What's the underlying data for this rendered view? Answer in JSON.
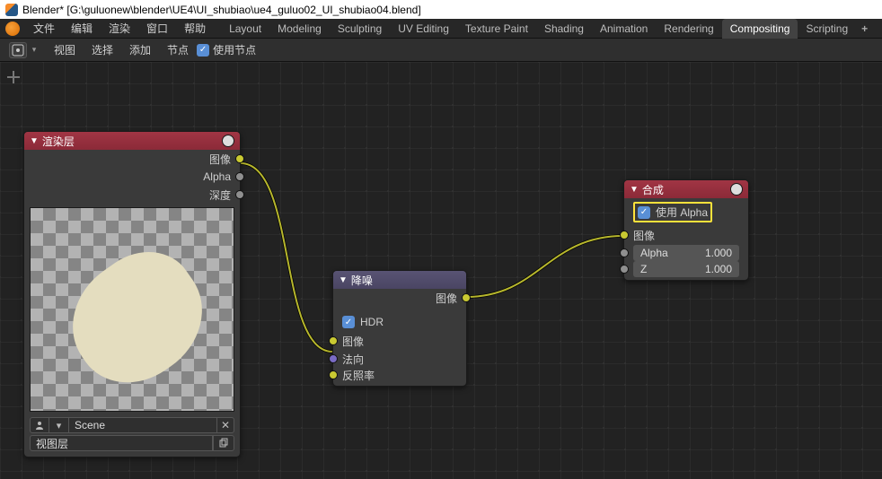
{
  "title": "Blender* [G:\\guluonew\\blender\\UE4\\UI_shubiao\\ue4_guluo02_UI_shubiao04.blend]",
  "topmenu": {
    "file": "文件",
    "edit": "编辑",
    "render": "渲染",
    "window": "窗口",
    "help": "帮助"
  },
  "workspaces": [
    "Layout",
    "Modeling",
    "Sculpting",
    "UV Editing",
    "Texture Paint",
    "Shading",
    "Animation",
    "Rendering",
    "Compositing",
    "Scripting"
  ],
  "header2": {
    "view": "视图",
    "select": "选择",
    "add": "添加",
    "node": "节点",
    "use_nodes": "使用节点"
  },
  "nodes": {
    "render_layers": {
      "title": "渲染层",
      "sockets": {
        "image": "图像",
        "alpha": "Alpha",
        "depth": "深度"
      },
      "scene": "Scene",
      "view_layer": "视图层"
    },
    "denoise": {
      "title": "降噪",
      "sockets_out": {
        "image": "图像"
      },
      "hdr": "HDR",
      "sockets_in": {
        "image": "图像",
        "normal": "法向",
        "albedo": "反照率"
      }
    },
    "composite": {
      "title": "合成",
      "use_alpha": "使用 Alpha",
      "sockets": {
        "image": "图像",
        "alpha": "Alpha",
        "z": "Z"
      },
      "alpha_val": "1.000",
      "z_val": "1.000"
    }
  }
}
